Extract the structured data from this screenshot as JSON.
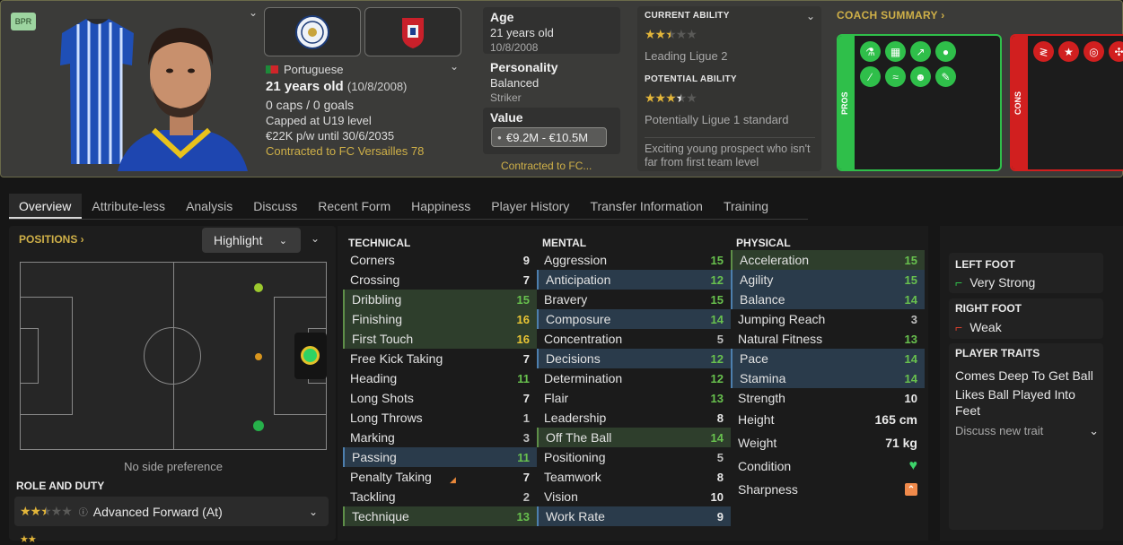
{
  "header": {
    "badge": "BPR",
    "nationality": "Portuguese",
    "age_line": "21 years old",
    "dob": "(10/8/2008)",
    "caps": "0 caps / 0 goals",
    "capped_level": "Capped at U19 level",
    "contract": "€22K p/w until 30/6/2035",
    "contracted_to": "Contracted to FC Versailles 78",
    "age_label": "Age",
    "age_value": "21 years old",
    "age_dob": "10/8/2008",
    "personality_label": "Personality",
    "personality_value": "Balanced",
    "position_value": "Striker",
    "value_label": "Value",
    "value_range": "€9.2M - €10.5M",
    "contracted_short": "Contracted to FC...",
    "current_ability_label": "CURRENT ABILITY",
    "current_ability_stars": 2.5,
    "current_ability_text": "Leading Ligue 2",
    "potential_ability_label": "POTENTIAL ABILITY",
    "potential_ability_stars": 3.5,
    "potential_ability_text": "Potentially Ligue 1 standard",
    "description": "Exciting young prospect who isn't far from first team level",
    "coach_summary": "COACH SUMMARY",
    "pros_label": "PROS",
    "cons_label": "CONS"
  },
  "tabs": [
    "Overview",
    "Attribute-less",
    "Analysis",
    "Discuss",
    "Recent Form",
    "Happiness",
    "Player History",
    "Transfer Information",
    "Training"
  ],
  "positions": {
    "label": "POSITIONS",
    "highlight_label": "Highlight",
    "side_pref": "No side preference",
    "role_duty_label": "ROLE AND DUTY",
    "role": "Advanced Forward (At)",
    "role_stars": 2.5
  },
  "technical": {
    "title": "TECHNICAL",
    "rows": [
      {
        "name": "Corners",
        "value": "9",
        "hl": ""
      },
      {
        "name": "Crossing",
        "value": "7",
        "hl": ""
      },
      {
        "name": "Dribbling",
        "value": "15",
        "hl": "g"
      },
      {
        "name": "Finishing",
        "value": "16",
        "hl": "g"
      },
      {
        "name": "First Touch",
        "value": "16",
        "hl": "g"
      },
      {
        "name": "Free Kick Taking",
        "value": "7",
        "hl": ""
      },
      {
        "name": "Heading",
        "value": "11",
        "hl": ""
      },
      {
        "name": "Long Shots",
        "value": "7",
        "hl": ""
      },
      {
        "name": "Long Throws",
        "value": "1",
        "hl": ""
      },
      {
        "name": "Marking",
        "value": "3",
        "hl": ""
      },
      {
        "name": "Passing",
        "value": "11",
        "hl": "b"
      },
      {
        "name": "Penalty Taking",
        "value": "7",
        "hl": ""
      },
      {
        "name": "Tackling",
        "value": "2",
        "hl": ""
      },
      {
        "name": "Technique",
        "value": "13",
        "hl": "g"
      }
    ]
  },
  "mental": {
    "title": "MENTAL",
    "rows": [
      {
        "name": "Aggression",
        "value": "15",
        "hl": ""
      },
      {
        "name": "Anticipation",
        "value": "12",
        "hl": "b"
      },
      {
        "name": "Bravery",
        "value": "15",
        "hl": ""
      },
      {
        "name": "Composure",
        "value": "14",
        "hl": "b"
      },
      {
        "name": "Concentration",
        "value": "5",
        "hl": ""
      },
      {
        "name": "Decisions",
        "value": "12",
        "hl": "b"
      },
      {
        "name": "Determination",
        "value": "12",
        "hl": ""
      },
      {
        "name": "Flair",
        "value": "13",
        "hl": ""
      },
      {
        "name": "Leadership",
        "value": "8",
        "hl": ""
      },
      {
        "name": "Off The Ball",
        "value": "14",
        "hl": "g"
      },
      {
        "name": "Positioning",
        "value": "5",
        "hl": ""
      },
      {
        "name": "Teamwork",
        "value": "8",
        "hl": ""
      },
      {
        "name": "Vision",
        "value": "10",
        "hl": ""
      },
      {
        "name": "Work Rate",
        "value": "9",
        "hl": "b"
      }
    ]
  },
  "physical": {
    "title": "PHYSICAL",
    "rows": [
      {
        "name": "Acceleration",
        "value": "15",
        "hl": "g"
      },
      {
        "name": "Agility",
        "value": "15",
        "hl": "b"
      },
      {
        "name": "Balance",
        "value": "14",
        "hl": "b"
      },
      {
        "name": "Jumping Reach",
        "value": "3",
        "hl": ""
      },
      {
        "name": "Natural Fitness",
        "value": "13",
        "hl": ""
      },
      {
        "name": "Pace",
        "value": "14",
        "hl": "b"
      },
      {
        "name": "Stamina",
        "value": "14",
        "hl": "b"
      },
      {
        "name": "Strength",
        "value": "10",
        "hl": ""
      }
    ],
    "height_label": "Height",
    "height_value": "165 cm",
    "weight_label": "Weight",
    "weight_value": "71 kg",
    "condition_label": "Condition",
    "sharpness_label": "Sharpness"
  },
  "side_panel": {
    "left_foot_label": "LEFT FOOT",
    "left_foot_value": "Very Strong",
    "right_foot_label": "RIGHT FOOT",
    "right_foot_value": "Weak",
    "traits_label": "PLAYER TRAITS",
    "trait1": "Comes Deep To Get Ball",
    "trait2": "Likes Ball Played Into Feet",
    "discuss_trait": "Discuss new trait"
  },
  "colors": {
    "accent_gold": "#cfb048",
    "pros": "#2fbf4a",
    "cons": "#d11f1f",
    "hl_green": "#2e3e2c",
    "hl_blue": "#2a3b4b"
  }
}
